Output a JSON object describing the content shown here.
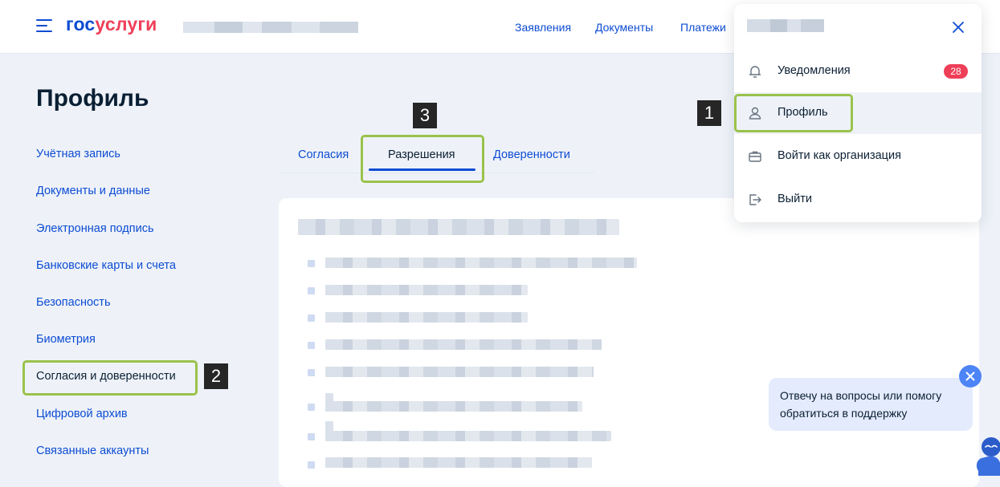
{
  "header": {
    "logo_part1": "гос",
    "logo_part2": "услуги",
    "nav": [
      "Заявления",
      "Документы",
      "Платежи"
    ]
  },
  "page": {
    "title": "Профиль"
  },
  "sidebar": {
    "items": [
      {
        "label": "Учётная запись"
      },
      {
        "label": "Документы и данные"
      },
      {
        "label": "Электронная подпись"
      },
      {
        "label": "Банковские карты и счета"
      },
      {
        "label": "Безопасность"
      },
      {
        "label": "Биометрия"
      },
      {
        "label": "Согласия и доверенности"
      },
      {
        "label": "Цифровой архив"
      },
      {
        "label": "Связанные аккаунты"
      }
    ]
  },
  "tabs": [
    {
      "label": "Согласия",
      "active": false
    },
    {
      "label": "Разрешения",
      "active": true
    },
    {
      "label": "Доверенности",
      "active": false
    }
  ],
  "dropdown": {
    "items": [
      {
        "label": "Уведомления",
        "icon": "bell-icon",
        "badge": "28"
      },
      {
        "label": "Профиль",
        "icon": "user-icon"
      },
      {
        "label": "Войти как организация",
        "icon": "briefcase-icon"
      },
      {
        "label": "Выйти",
        "icon": "logout-icon"
      }
    ]
  },
  "annotations": {
    "step1": "1",
    "step2": "2",
    "step3": "3"
  },
  "chat": {
    "message": "Отвечу на вопросы или помогу обратиться в поддержку"
  },
  "colors": {
    "brand_blue": "#0d4cd3",
    "brand_red": "#ee3f58",
    "highlight_green": "#9ac24b",
    "badge_red": "#ee3f58"
  }
}
